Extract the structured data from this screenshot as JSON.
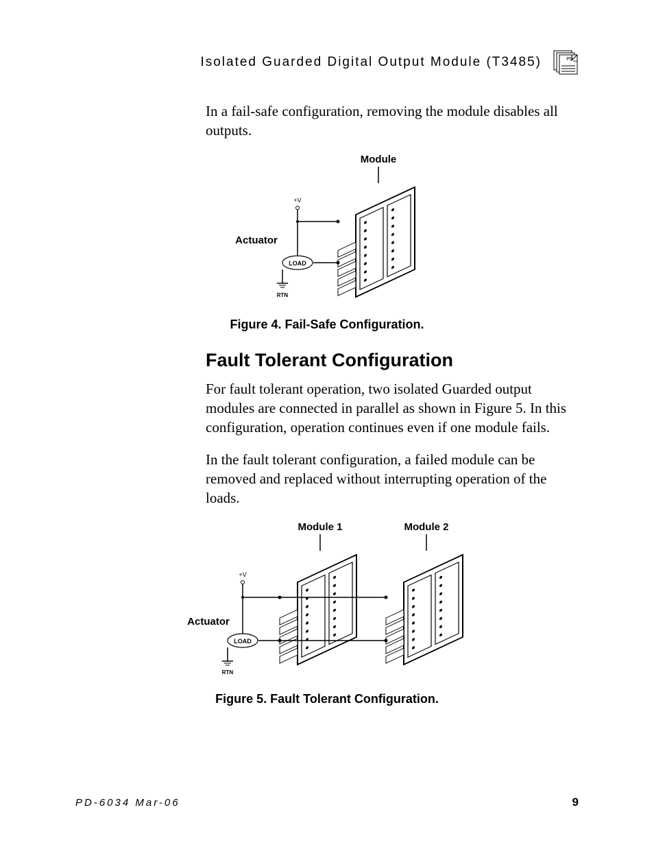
{
  "header": {
    "title": "Isolated  Guarded  Digital  Output  Module (T3485)",
    "icon_label": "PD"
  },
  "p1": "In a fail-safe configuration, removing the module disables all outputs.",
  "fig4": {
    "module_label": "Module",
    "actuator_label": "Actuator",
    "load_label": "LOAD",
    "v_label": "+V",
    "rtn_label": "RTN",
    "caption": "Figure 4.  Fail-Safe Configuration."
  },
  "h2": "Fault Tolerant Configuration",
  "p2": "For fault tolerant operation, two isolated Guarded output modules are connected in parallel as shown in Figure 5.  In this configuration, operation continues even if one module fails.",
  "p3": "In the fault tolerant configuration, a failed module can be removed and replaced without interrupting operation of the loads.",
  "fig5": {
    "module1_label": "Module 1",
    "module2_label": "Module 2",
    "actuator_label": "Actuator",
    "load_label": "LOAD",
    "v_label": "+V",
    "rtn_label": "RTN",
    "caption": "Figure 5.  Fault Tolerant Configuration."
  },
  "footer": {
    "left": "PD-6034  Mar-06",
    "right": "9"
  }
}
